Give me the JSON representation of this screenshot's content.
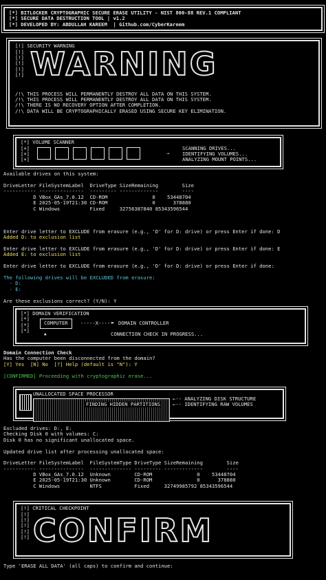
{
  "header": {
    "line1": "[*] BITLOCKER CRYPTOGRAPHIC SECURE ERASE UTILITY - NIST 800-88 REV.1 COMPLIANT",
    "line2": "[*] SECURE DATA DESTRUCTION TOOL | v1.2",
    "line3": "[*] DEVELOPED BY: ABDULLAH KAREEM  | Github.com/CyberKareem"
  },
  "warning": {
    "title": "[!] SECURITY WARNING",
    "big": "WARNING",
    "marks": [
      "[!]",
      "[!]",
      "[!]",
      "[!]",
      "[!]"
    ],
    "lines": [
      "/!\\ THIS PROCESS WILL PERMANENTLY DESTROY ALL DATA ON THIS SYSTEM.",
      "/!\\ THIS PROCESS WILL PERMANENTLY DESTROY ALL DATA ON THIS SYSTEM.",
      "/!\\ THERE IS NO RECOVERY OPTION AFTER COMPLETION.",
      "/!\\ DATA WILL BE CRYPTOGRAPHICALLY ERASED USING SECURE KEY ELIMINATION."
    ]
  },
  "scanner": {
    "title": "[*] VOLUME SCANNER",
    "marks": [
      "[+]",
      "[+]",
      "[+]"
    ],
    "arrow": "→",
    "status": [
      "SCANNING DRIVES...",
      "IDENTIFYING VOLUMES...",
      "ANALYZING MOUNT POINTS..."
    ]
  },
  "drives": {
    "intro": "Available drives on this system:",
    "header": "DriveLetter FileSystemLabel  DriveType SizeRemaining        Size",
    "dashes": "----------- ---------------  --------- -------------        ----",
    "rows": [
      "          D VBox_GAs_7.0.12  CD-ROM               0    53448704",
      "          E 2025-05-19T21:30 CD-ROM               0      378880",
      "          C Windows          Fixed     32756387840 85343596544"
    ]
  },
  "exclusion": {
    "prompt1": "Enter drive letter to EXCLUDE from erasure (e.g., 'D' for D: drive) or press Enter if done: D",
    "added1": "Added D: to exclusion list",
    "prompt2": "Enter drive letter to EXCLUDE from erasure (e.g., 'D' for D: drive) or press Enter if done: E",
    "added2": "Added E: to exclusion list",
    "prompt3": "Enter drive letter to EXCLUDE from erasure (e.g., 'D' for D: drive) or press Enter if done:",
    "following": "The following drives will be EXCLUDED from erasure:",
    "d": "  - D:",
    "e": "  - E:",
    "confirm": "Are these exclusions correct? (Y/N): Y"
  },
  "domain": {
    "title": "[*] DOMAIN VERIFICATION",
    "marks": [
      "[*]",
      "[*]",
      "[*]"
    ],
    "computer": "COMPUTER",
    "link": "-----X-----",
    "controller": "DOMAIN CONTROLLER",
    "status": "CONNECTION CHECK IN PROGRESS..."
  },
  "domain_check": {
    "title": "Domain Connection Check",
    "question": "Has the computer been disconnected from the domain?",
    "options": "[Y] Yes  [N] No  [?] Help (default is \"N\"): Y",
    "confirmed": "[CONFIRMED] Proceeding with cryptographic erase..."
  },
  "unallocated": {
    "title": "UNALLOCATED SPACE PROCESSOR",
    "finding": "FINDING HIDDEN PARTITIONS",
    "analyzing": "←-- ANALYZING DISK STRUCTURE",
    "identifying": "←-- IDENTIFYING RAW VOLUMES"
  },
  "excluded": {
    "line1": "Excluded drives: D:, E:",
    "line2": "Checking Disk 0 with volumes: C:",
    "line3": "Disk 0 has no significant unallocated space.",
    "updated": "Updated drive list after processing unallocated space:"
  },
  "drives2": {
    "header": "DriveLetter FileSystemLabel  FileSystemType DriveType SizeRemaining        Size",
    "dashes": "----------- ---------------  -------------- --------- -------------        ----",
    "rows": [
      "          D VBox_GAs_7.0.12  Unknown        CD-ROM               0    53448704",
      "          E 2025-05-19T21:30 Unknown        CD-ROM               0      378880",
      "          C Windows          NTFS           Fixed     32749985792 85343596544"
    ]
  },
  "critical": {
    "title": "[!] CRITICAL CHECKPOINT",
    "marks": [
      "[!]",
      "[!]",
      "[!]",
      "[!]",
      "[!]"
    ],
    "big": "CONFIRM"
  },
  "final": {
    "prompt": "Type 'ERASE ALL DATA' (all caps) to confirm and continue:"
  }
}
